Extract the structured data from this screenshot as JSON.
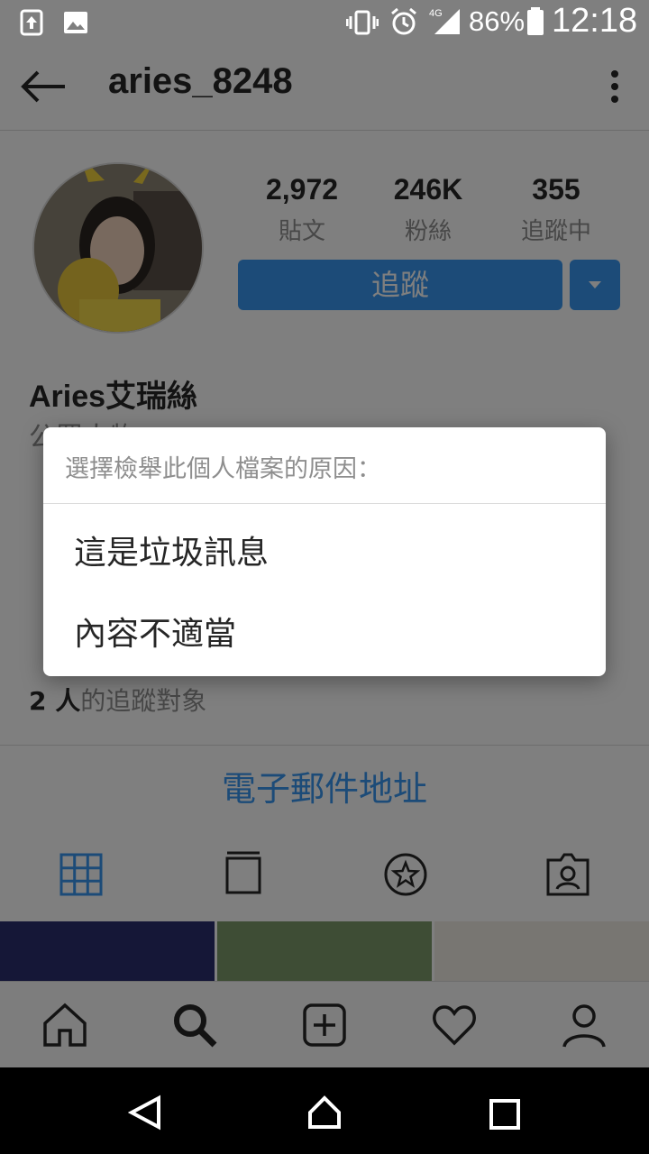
{
  "status_bar": {
    "battery": "86%",
    "time": "12:18",
    "network": "4G"
  },
  "header": {
    "username": "aries_8248",
    "back_icon": "arrow-left-icon",
    "menu_icon": "more-vertical-icon"
  },
  "profile": {
    "stats": [
      {
        "value": "2,972",
        "label": "貼文"
      },
      {
        "value": "246K",
        "label": "粉絲"
      },
      {
        "value": "355",
        "label": "追蹤中"
      }
    ],
    "follow_label": "追蹤",
    "full_name": "Aries艾瑞絲",
    "category": "公眾人物",
    "followed_by_count": "2 人",
    "followed_by_suffix": "的追蹤對象",
    "email_label": "電子郵件地址"
  },
  "dialog": {
    "title": "選擇檢舉此個人檔案的原因：",
    "options": [
      {
        "label": "這是垃圾訊息"
      },
      {
        "label": "內容不適當"
      }
    ]
  },
  "colors": {
    "accent": "#3897f0",
    "scrim": "rgba(0,0,0,0.5)"
  },
  "icons": {
    "tabs": [
      "grid-icon",
      "feed-icon",
      "star-icon",
      "tagged-icon"
    ],
    "nav": [
      "home-icon",
      "search-icon",
      "add-icon",
      "heart-icon",
      "profile-icon"
    ],
    "android": [
      "back-icon",
      "home-icon",
      "recents-icon"
    ]
  }
}
